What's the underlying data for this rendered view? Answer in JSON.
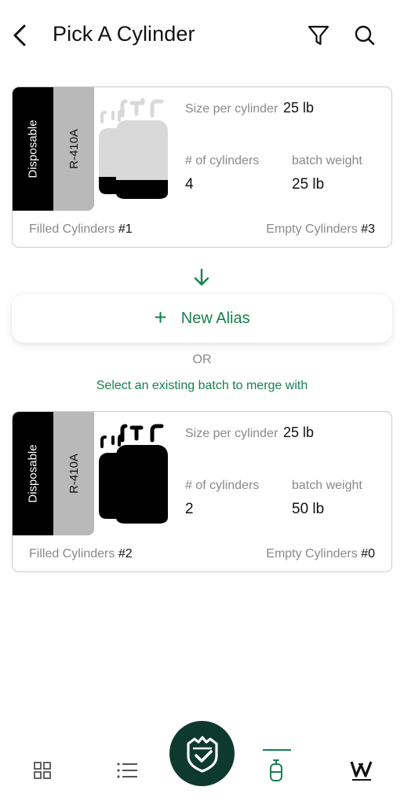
{
  "header": {
    "title": "Pick A Cylinder",
    "back_icon": "chevron-left-icon",
    "filter_icon": "filter-icon",
    "search_icon": "search-icon"
  },
  "cards": [
    {
      "type_label": "Disposable",
      "refrigerant": "R-410A",
      "size_label": "Size per cylinder",
      "size_value": "25 lb",
      "count_label": "# of cylinders",
      "count_value": "4",
      "weight_label": "batch weight",
      "weight_value": "25 lb",
      "filled_label": "Filled Cylinders",
      "filled_value": "#1",
      "empty_label": "Empty Cylinders",
      "empty_value": "#3",
      "cylinder_fill_level": 0.25
    },
    {
      "type_label": "Disposable",
      "refrigerant": "R-410A",
      "size_label": "Size per cylinder",
      "size_value": "25 lb",
      "count_label": "# of cylinders",
      "count_value": "2",
      "weight_label": "batch weight",
      "weight_value": "50 lb",
      "filled_label": "Filled Cylinders",
      "filled_value": "#2",
      "empty_label": "Empty Cylinders",
      "empty_value": "#0",
      "cylinder_fill_level": 1.0
    }
  ],
  "new_alias": {
    "label": "New Alias",
    "icon": "plus-icon"
  },
  "or_text": "OR",
  "merge_text": "Select an existing batch to merge with",
  "bottom_nav": {
    "items": [
      "grid-icon",
      "list-icon",
      "shield-check-icon",
      "cylinder-icon",
      "brand-w-icon"
    ],
    "active": "cylinder-icon"
  },
  "colors": {
    "accent": "#178050",
    "center_button": "#0e3a2e",
    "type_strip": "#000000",
    "ref_strip": "#b9b9b9",
    "cylinder_empty": "#d9d9d9",
    "cylinder_filled": "#000000"
  }
}
